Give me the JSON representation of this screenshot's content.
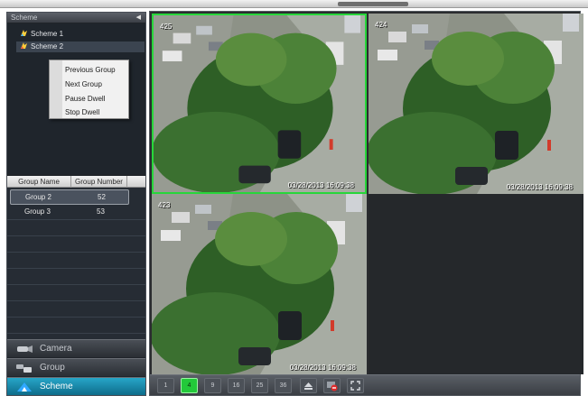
{
  "sidebar": {
    "header_title": "Scheme",
    "tree_items": [
      {
        "label": "Scheme 1"
      },
      {
        "label": "Scheme 2"
      }
    ],
    "context_menu": [
      {
        "label": "Previous Group"
      },
      {
        "label": "Next Group"
      },
      {
        "label": "Pause Dwell"
      },
      {
        "label": "Stop Dwell"
      }
    ],
    "group_table": {
      "columns": [
        "Group Name",
        "Group Number"
      ],
      "rows": [
        {
          "name": "Group 2",
          "number": "52"
        },
        {
          "name": "Group 3",
          "number": "53"
        }
      ]
    },
    "nav": [
      {
        "label": "Camera",
        "icon": "camera-icon"
      },
      {
        "label": "Group",
        "icon": "group-icon"
      },
      {
        "label": "Scheme",
        "icon": "scheme-icon"
      }
    ]
  },
  "video": {
    "tiles": [
      {
        "channel": "425",
        "timestamp": "03/28/2013  16:09:38",
        "active": true
      },
      {
        "channel": "424",
        "timestamp": "03/28/2013  16:09:38",
        "active": false
      },
      {
        "channel": "423",
        "timestamp": "03/28/2013  16:09:38",
        "active": false
      }
    ],
    "toolbar": [
      {
        "label": "1",
        "icon": "layout-1-icon"
      },
      {
        "label": "4",
        "icon": "layout-4-icon",
        "active": true
      },
      {
        "label": "9",
        "icon": "layout-9-icon"
      },
      {
        "label": "16",
        "icon": "layout-16-icon"
      },
      {
        "label": "25",
        "icon": "layout-25-icon"
      },
      {
        "label": "36",
        "icon": "layout-36-icon"
      },
      {
        "label": "",
        "icon": "eject-icon"
      },
      {
        "label": "",
        "icon": "stop-all-icon"
      },
      {
        "label": "",
        "icon": "fullscreen-icon"
      }
    ]
  },
  "colors": {
    "active_tile_border": "#27d63a",
    "active_nav": "#1a8fb0",
    "panel_bg": "#20242a"
  }
}
